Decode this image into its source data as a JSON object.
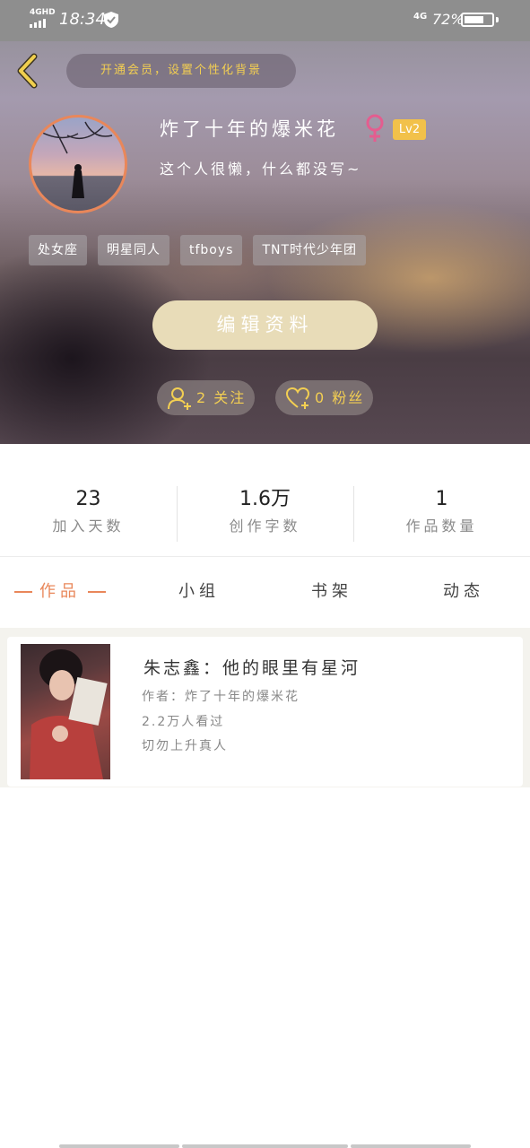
{
  "status_bar": {
    "network": "4GHD",
    "time": "18:34",
    "network_right": "4G",
    "battery": "72%",
    "battery_level": 0.72
  },
  "header": {
    "vip_banner": "开通会员，设置个性化背景",
    "username": "炸了十年的爆米花",
    "level": "Lv2",
    "bio": "这个人很懒，什么都没写~",
    "tags": [
      "处女座",
      "明星同人",
      "tfboys",
      "TNT时代少年团"
    ],
    "edit_button": "编辑资料",
    "following": "2 关注",
    "fans": "0 粉丝",
    "accent_color": "#e9875a",
    "highlight_color": "#f3cf52"
  },
  "stats": [
    {
      "value": "23",
      "label": "加入天数"
    },
    {
      "value": "1.6万",
      "label": "创作字数"
    },
    {
      "value": "1",
      "label": "作品数量"
    }
  ],
  "tabs": [
    {
      "label": "作品",
      "active": true
    },
    {
      "label": "小组",
      "active": false
    },
    {
      "label": "书架",
      "active": false
    },
    {
      "label": "动态",
      "active": false
    }
  ],
  "works": [
    {
      "title": "朱志鑫：他的眼里有星河",
      "author": "作者：炸了十年的爆米花",
      "views": "2.2万人看过",
      "tag": "切勿上升真人"
    }
  ]
}
